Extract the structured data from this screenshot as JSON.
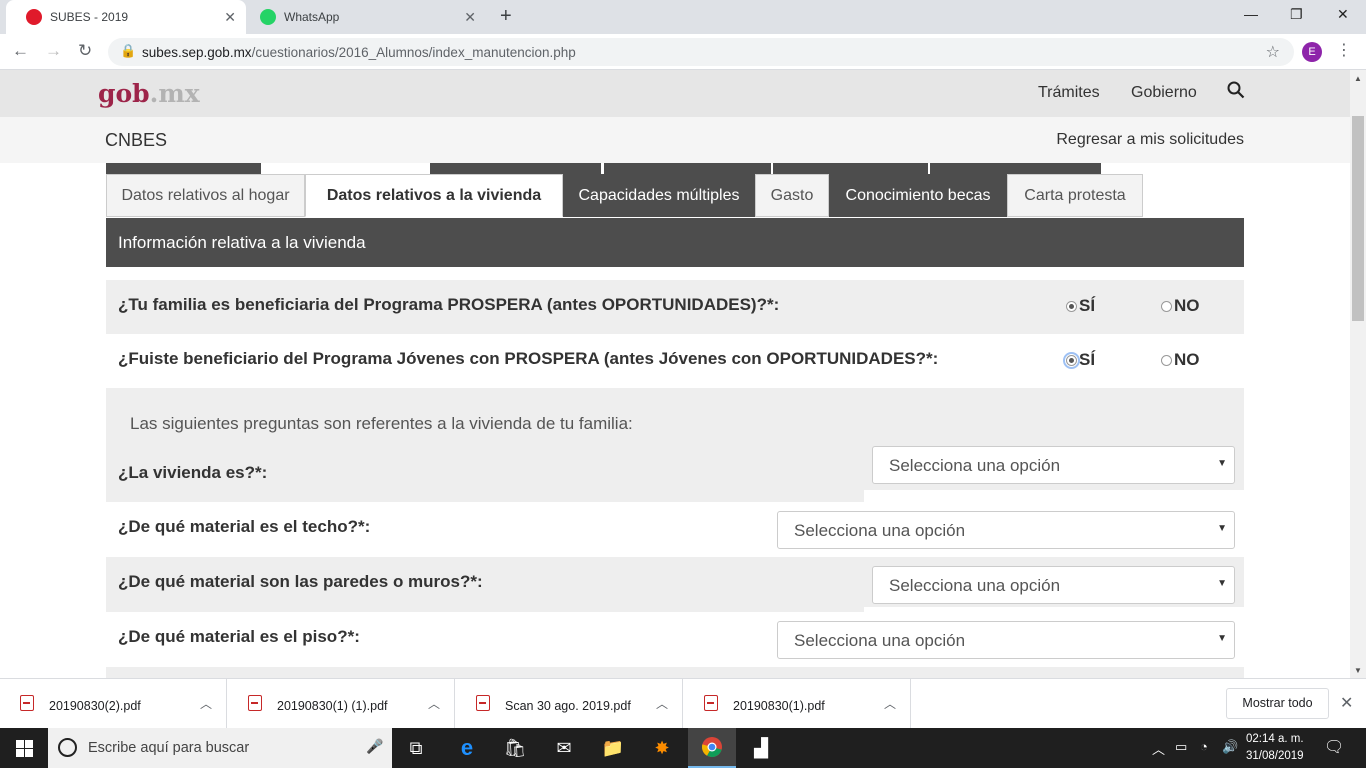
{
  "browser": {
    "tabs": [
      {
        "title": "SUBES - 2019",
        "active": true,
        "favicon_color": "#e01a2b"
      },
      {
        "title": "WhatsApp",
        "active": false,
        "favicon_color": "#25d366"
      }
    ],
    "new_tab_label": "+",
    "url_host": "subes.sep.gob.mx",
    "url_path": "/cuestionarios/2016_Alumnos/index_manutencion.php",
    "profile_initial": "E"
  },
  "site": {
    "logo_main": "gob",
    "logo_suffix": ".mx",
    "nav": [
      "Trámites",
      "Gobierno"
    ],
    "section_name": "CNBES",
    "back_link": "Regresar a mis solicitudes"
  },
  "form_tabs": [
    {
      "label": "Datos relativos al hogar",
      "style": "light"
    },
    {
      "label": "Datos relativos a la vivienda",
      "style": "active"
    },
    {
      "label": "Capacidades múltiples",
      "style": "dark"
    },
    {
      "label": "Gasto",
      "style": "light"
    },
    {
      "label": "Conocimiento becas",
      "style": "dark"
    },
    {
      "label": "Carta protesta",
      "style": "light"
    }
  ],
  "section_title": "Información relativa a la vivienda",
  "yes_no_questions": [
    {
      "question": "¿Tu familia es beneficiaria del Programa PROSPERA (antes OPORTUNIDADES)?*:",
      "yes_label": "SÍ",
      "no_label": "NO",
      "selected": "yes"
    },
    {
      "question": "¿Fuiste beneficiario del Programa Jóvenes con PROSPERA (antes Jóvenes con OPORTUNIDADES?*:",
      "yes_label": "SÍ",
      "no_label": "NO",
      "selected": "yes"
    }
  ],
  "intro_text": "Las siguientes preguntas son referentes a la vivienda de tu familia:",
  "select_questions": [
    {
      "question": "¿La vivienda es?*:",
      "value": "Selecciona una opción"
    },
    {
      "question": "¿De qué material es el techo?*:",
      "value": "Selecciona una opción"
    },
    {
      "question": "¿De qué material son las paredes o muros?*:",
      "value": "Selecciona una opción"
    },
    {
      "question": "¿De qué material es el piso?*:",
      "value": "Selecciona una opción"
    }
  ],
  "downloads": [
    {
      "file": "20190830(2).pdf"
    },
    {
      "file": "20190830(1) (1).pdf"
    },
    {
      "file": "Scan 30 ago. 2019.pdf"
    },
    {
      "file": "20190830(1).pdf"
    }
  ],
  "show_all_label": "Mostrar todo",
  "taskbar": {
    "search_placeholder": "Escribe aquí para buscar",
    "time": "02:14 a. m.",
    "date": "31/08/2019"
  }
}
